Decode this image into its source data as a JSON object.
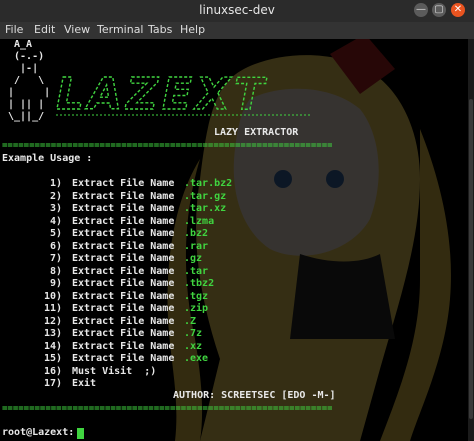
{
  "window": {
    "title": "linuxsec-dev",
    "buttons": {
      "minimize_glyph": "—",
      "maximize_glyph": "▢",
      "close_glyph": "✕"
    }
  },
  "menu": [
    "File",
    "Edit",
    "View",
    "Terminal",
    "Tabs",
    "Help"
  ],
  "terminal": {
    "ascii_art": " A_A\n (-.-)\n  |-|\n /   \\\n|     |\n| || |\n\\_||_/",
    "logo_text": "LAZEXT",
    "subtitle": "LAZY EXTRACTOR",
    "rule": "==============================================================================",
    "usage_heading": "Example Usage :",
    "options": [
      {
        "num": "1)",
        "label": "Extract File Name",
        "ext": ".tar.bz2"
      },
      {
        "num": "2)",
        "label": "Extract File Name",
        "ext": ".tar.gz"
      },
      {
        "num": "3)",
        "label": "Extract File Name",
        "ext": ".tar.xz"
      },
      {
        "num": "4)",
        "label": "Extract File Name",
        "ext": ".lzma"
      },
      {
        "num": "5)",
        "label": "Extract File Name",
        "ext": ".bz2"
      },
      {
        "num": "6)",
        "label": "Extract File Name",
        "ext": ".rar"
      },
      {
        "num": "7)",
        "label": "Extract File Name",
        "ext": ".gz"
      },
      {
        "num": "8)",
        "label": "Extract File Name",
        "ext": ".tar"
      },
      {
        "num": "9)",
        "label": "Extract File Name",
        "ext": ".tbz2"
      },
      {
        "num": "10)",
        "label": "Extract File Name",
        "ext": ".tgz"
      },
      {
        "num": "11)",
        "label": "Extract File Name",
        "ext": ".zip"
      },
      {
        "num": "12)",
        "label": "Extract File Name",
        "ext": ".Z"
      },
      {
        "num": "13)",
        "label": "Extract File Name",
        "ext": ".7z"
      },
      {
        "num": "14)",
        "label": "Extract File Name",
        "ext": ".xz"
      },
      {
        "num": "15)",
        "label": "Extract File Name",
        "ext": ".exe"
      },
      {
        "num": "16)",
        "label": "Must Visit  ;)",
        "ext": ""
      },
      {
        "num": "17)",
        "label": "Exit",
        "ext": ""
      }
    ],
    "author": "AUTHOR: SCREETSEC [EDO -M-]",
    "prompt": "root@Lazext:"
  },
  "colors": {
    "accent_green": "#40d440",
    "text": "#e8e8e8",
    "background": "#000000",
    "close_button": "#e95420"
  },
  "icons": [
    "minimize-icon",
    "maximize-icon",
    "close-icon"
  ]
}
